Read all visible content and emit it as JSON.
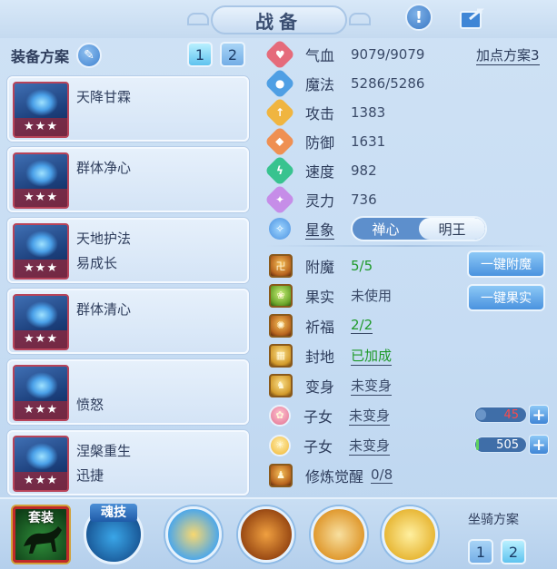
{
  "header": {
    "title": "战备"
  },
  "equip_scheme": {
    "title": "装备方案",
    "nums": [
      "1",
      "2"
    ],
    "items": [
      {
        "name": "天降甘霖",
        "sub": "",
        "stars": "★★★"
      },
      {
        "name": "群体净心",
        "sub": "",
        "stars": "★★★"
      },
      {
        "name": "天地护法",
        "sub": "易成长",
        "stars": "★★★"
      },
      {
        "name": "群体清心",
        "sub": "",
        "stars": "★★★"
      },
      {
        "name": "",
        "sub": "愤怒",
        "stars": "★★★"
      },
      {
        "name": "涅槃重生",
        "sub": "迅捷",
        "stars": "★★★"
      }
    ]
  },
  "stats": {
    "plan_link": "加点方案3",
    "rows": [
      {
        "label": "气血",
        "value": "9079/9079",
        "color": "#e56b7b"
      },
      {
        "label": "魔法",
        "value": "5286/5286",
        "color": "#4f9fe4"
      },
      {
        "label": "攻击",
        "value": "1383",
        "color": "#f0b540"
      },
      {
        "label": "防御",
        "value": "1631",
        "color": "#ef9052"
      },
      {
        "label": "速度",
        "value": "982",
        "color": "#38c38f"
      },
      {
        "label": "灵力",
        "value": "736",
        "color": "#c68de8"
      }
    ],
    "xingxiang": {
      "label": "星象",
      "options": [
        "禅心",
        "明王"
      ],
      "active": 1
    }
  },
  "enchant": {
    "rows": [
      {
        "label": "附魔",
        "value": "5/5"
      },
      {
        "label": "果实",
        "value": "未使用"
      },
      {
        "label": "祈福",
        "value": "2/2"
      },
      {
        "label": "封地",
        "value": "已加成"
      },
      {
        "label": "变身",
        "value": "未变身"
      },
      {
        "label": "子女",
        "value": "未变身"
      },
      {
        "label": "子女",
        "value": "未变身"
      },
      {
        "label": "修炼觉醒",
        "value": "0/8"
      }
    ],
    "buttons": {
      "fumo": "一键附魔",
      "guoshi": "一键果实"
    },
    "children": [
      {
        "value": "45",
        "level": 0.2
      },
      {
        "value": "505",
        "level": 0.05
      }
    ],
    "plus": "+"
  },
  "bottom": {
    "tao_label": "套装",
    "hun_label": "魂技",
    "mount_title": "坐骑方案",
    "mount_nums": [
      "1",
      "2"
    ]
  }
}
